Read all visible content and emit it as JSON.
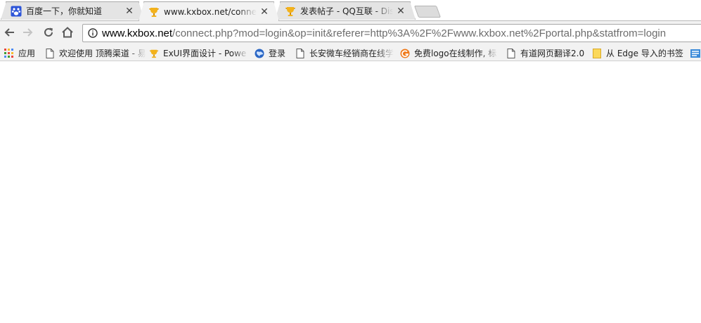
{
  "tabs": [
    {
      "title": "百度一下，你就知道",
      "favicon": "baidu-paw-icon",
      "active": false
    },
    {
      "title": "www.kxbox.net/connect.php?mod=login",
      "favicon": "kxbox-trophy-icon",
      "active": true
    },
    {
      "title": "发表帖子 - QQ互联 - Discuz",
      "favicon": "kxbox-trophy-icon",
      "active": false
    }
  ],
  "toolbar": {
    "back_icon": "back-arrow-icon",
    "forward_icon": "forward-arrow-icon",
    "reload_icon": "reload-icon",
    "home_icon": "home-icon",
    "info_icon": "info-icon"
  },
  "address": {
    "host": "www.kxbox.net",
    "rest": "/connect.php?mod=login&op=init&referer=http%3A%2F%2Fwww.kxbox.net%2Fportal.php&statfrom=login"
  },
  "bookmarks": [
    {
      "label": "应用",
      "icon": "apps-grid-icon"
    },
    {
      "label": "欢迎使用 顶腾渠道 - 易",
      "icon": "page-icon"
    },
    {
      "label": "ExUI界面设计 - Powe",
      "icon": "kxbox-trophy-icon"
    },
    {
      "label": "登录",
      "icon": "globe-icon"
    },
    {
      "label": "长安微车经销商在线学",
      "icon": "page-icon"
    },
    {
      "label": "免费logo在线制作, 标",
      "icon": "orange-logo-icon"
    },
    {
      "label": "有道网页翻译2.0",
      "icon": "page-icon"
    },
    {
      "label": "从 Edge 导入的书签",
      "icon": "folder-icon"
    }
  ],
  "colors": {
    "chrome_bg": "#f2f2f2",
    "tab_inactive": "#e4e4e4",
    "url_host": "#000000",
    "url_rest": "#6d6d6d"
  }
}
